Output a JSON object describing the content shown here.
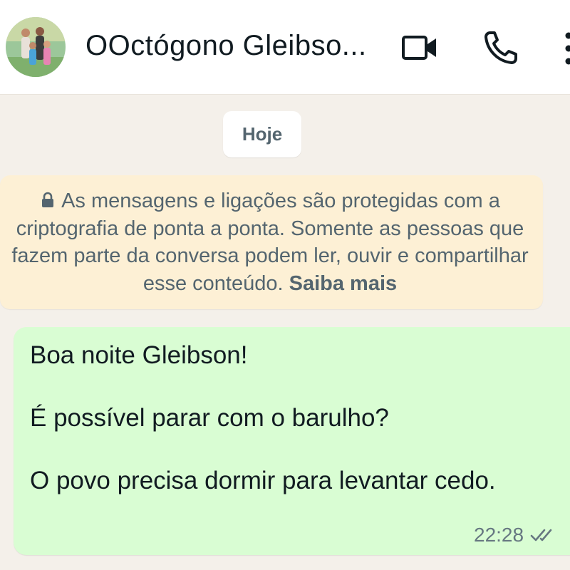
{
  "header": {
    "contact_name": "OOctógono Gleibso...",
    "avatar": "avatar-photo",
    "icons": [
      "video-call-icon",
      "voice-call-icon",
      "more-options-icon"
    ]
  },
  "chat": {
    "date_chip": "Hoje",
    "encryption_notice": {
      "text": "As mensagens e ligações são protegidas com a criptografia de ponta a ponta. Somente as pessoas que fazem parte da conversa podem ler, ouvir e compartilhar esse conteúdo.",
      "link": "Saiba mais"
    },
    "messages": [
      {
        "direction": "outgoing",
        "text": "Boa noite Gleibson!\n\nÉ possível parar com o barulho?\n\nO povo precisa dormir para levantar cedo.",
        "time": "22:28",
        "status": "delivered"
      }
    ]
  },
  "colors": {
    "chat_background": "#f4f0ea",
    "outgoing_bubble": "#d9fdd3",
    "notice_background": "#fdf0d5",
    "text_primary": "#111b21",
    "text_secondary": "#54656f"
  }
}
